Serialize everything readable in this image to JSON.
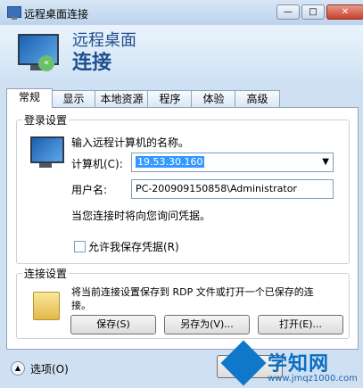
{
  "window": {
    "title": "远程桌面连接",
    "controls": [
      "—",
      "□",
      "✕"
    ]
  },
  "header": {
    "subtitle": "远程桌面",
    "title": "连接"
  },
  "tabs": [
    "常规",
    "显示",
    "本地资源",
    "程序",
    "体验",
    "高级"
  ],
  "login": {
    "group_title": "登录设置",
    "prompt": "输入远程计算机的名称。",
    "computer_label": "计算机(C):",
    "computer_value": "19.53.30.160",
    "username_label": "用户名:",
    "username_value": "PC-200909150858\\Administrator",
    "note": "当您连接时将向您询问凭据。",
    "save_credentials": "允许我保存凭据(R)"
  },
  "connection": {
    "group_title": "连接设置",
    "description_line1": "将当前连接设置保存到 RDP 文件或打开一个已保存的连",
    "description_line2": "接。",
    "save_label": "保存(S)",
    "save_as_label": "另存为(V)...",
    "open_label": "打开(E)..."
  },
  "footer": {
    "options_label": "选项(O)"
  },
  "watermark": {
    "name": "学知网",
    "url": "www.jmqz1000.com"
  }
}
